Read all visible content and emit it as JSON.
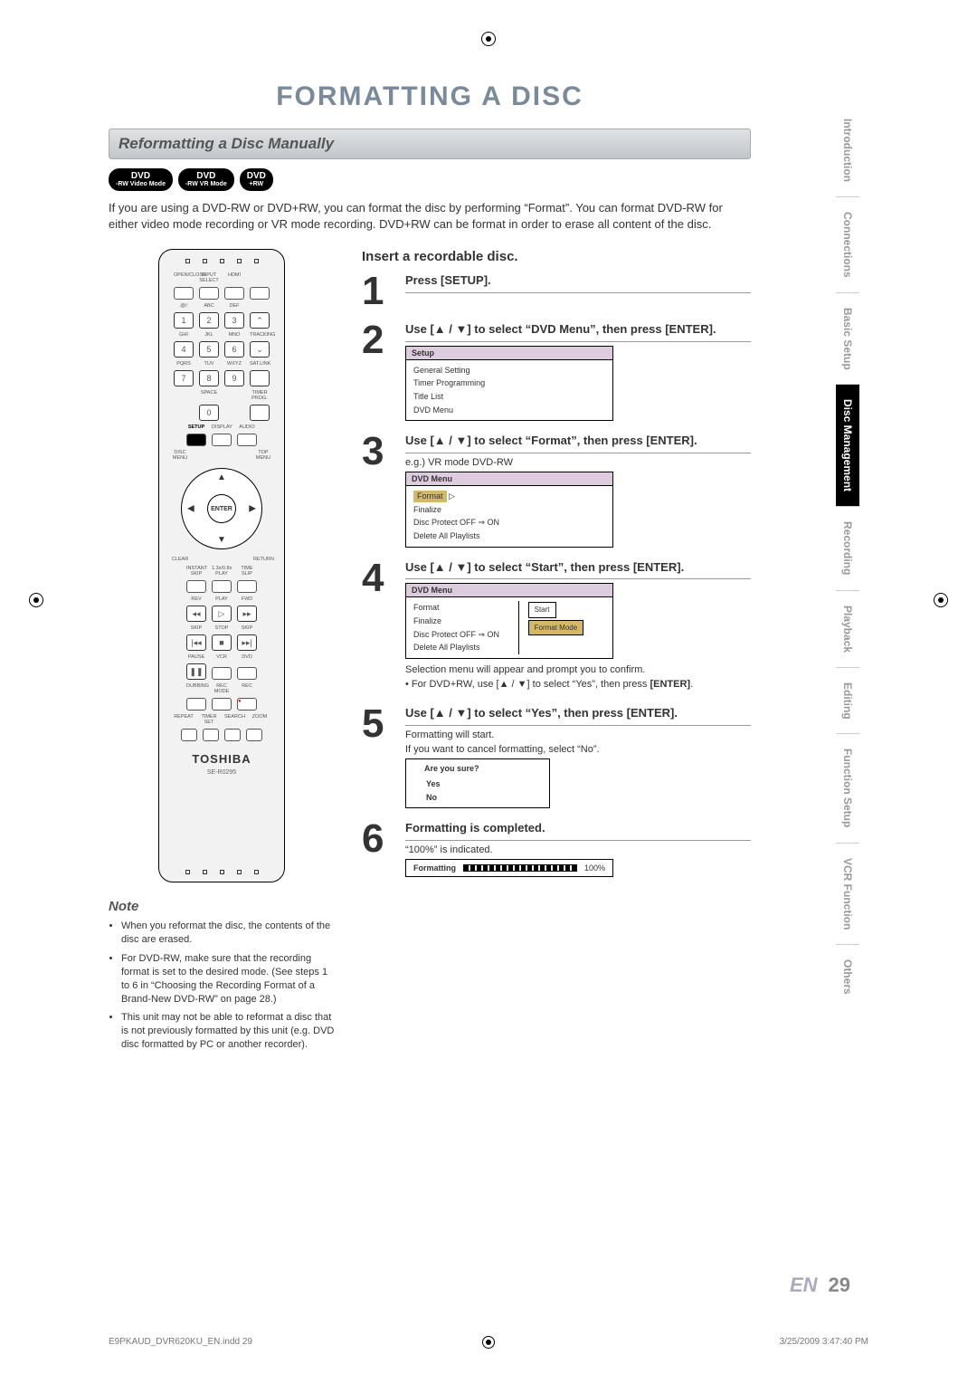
{
  "page_title": "FORMATTING A DISC",
  "subtitle": "Reformatting a Disc Manually",
  "badges": [
    {
      "top": "DVD",
      "bottom": "-RW Video Mode"
    },
    {
      "top": "DVD",
      "bottom": "-RW VR Mode"
    },
    {
      "top": "DVD",
      "bottom": "+RW"
    }
  ],
  "intro": "If you are using a DVD-RW or DVD+RW, you can format the disc by performing “Format”. You can format DVD-RW for either video mode recording or VR mode recording. DVD+RW can be format in order to erase all content of the disc.",
  "remote": {
    "brand": "TOSHIBA",
    "model": "SE-R0295",
    "labels": {
      "openclose": "OPEN/CLOSE",
      "inputsel": "INPUT SELECT",
      "hdmi": "HDMI",
      "abc": "ABC",
      "def": "DEF",
      "ghi": "GHI",
      "jkl": "JKL",
      "mno": "MNO",
      "tracking": "TRACKING",
      "pqrs": "PQRS",
      "tuv": "TUV",
      "wxyz": "WXYZ",
      "satlink": "SAT.LINK",
      "space": "SPACE",
      "timerprog": "TIMER PROG.",
      "setup": "SETUP",
      "display": "DISPLAY",
      "audio": "AUDIO",
      "discmenu": "DISC MENU",
      "topmenu": "TOP MENU",
      "enter": "ENTER",
      "clear": "CLEAR",
      "return": "RETURN",
      "instantskip": "INSTANT SKIP",
      "play13": "1.3x/0.8x PLAY",
      "timeslip": "TIME SLIP",
      "rev": "REV",
      "play": "PLAY",
      "fwd": "FWD",
      "skip": "SKIP",
      "stop": "STOP",
      "pause": "PAUSE",
      "vcr": "VCR",
      "dvd": "DVD",
      "dubbing": "DUBBING",
      "recmode": "REC MODE",
      "rec": "REC",
      "repeat": "REPEAT",
      "timerset": "TIMER SET",
      "search": "SEARCH",
      "zoom": "ZOOM"
    },
    "nums": {
      "1": "1",
      "2": "2",
      "3": "3",
      "4": "4",
      "5": "5",
      "6": "6",
      "7": "7",
      "8": "8",
      "9": "9",
      "0": "0"
    }
  },
  "note_title": "Note",
  "notes": [
    "When you reformat the disc, the contents of the disc are erased.",
    "For DVD-RW, make sure that the recording format is set to the desired mode. (See steps 1 to 6 in “Choosing the Recording Format of a Brand-New DVD-RW” on page 28.)",
    "This unit may not be able to reformat a disc that is not previously formatted by this unit (e.g. DVD disc formatted by PC or another recorder)."
  ],
  "insert_title": "Insert a recordable disc.",
  "steps": {
    "1": {
      "head": "Press [SETUP]."
    },
    "2": {
      "head": "Use [▲ / ▼] to select “DVD Menu”, then press [ENTER].",
      "osd_title": "Setup",
      "osd_items": [
        "General Setting",
        "Timer Programming",
        "Title List",
        "DVD Menu"
      ]
    },
    "3": {
      "head": "Use [▲ / ▼] to select “Format”, then press [ENTER].",
      "sub": "e.g.) VR mode DVD-RW",
      "osd_title": "DVD Menu",
      "osd_items": [
        "Format",
        "Finalize",
        "Disc Protect OFF ⇒ ON",
        "Delete All Playlists"
      ],
      "hl": "Format"
    },
    "4": {
      "head": "Use [▲ / ▼] to select “Start”, then press [ENTER].",
      "osd_title": "DVD Menu",
      "osd_left": [
        "Format",
        "Finalize",
        "Disc Protect OFF ⇒ ON",
        "Delete All Playlists"
      ],
      "osd_right": [
        "Start",
        "Format Mode"
      ],
      "after1": "Selection menu will appear and prompt you to confirm.",
      "after2_a": "• For DVD+RW, use [▲ / ▼] to select “Yes”, then press ",
      "after2_b": "[ENTER]"
    },
    "5": {
      "head": "Use [▲ / ▼] to select “Yes”, then press [ENTER].",
      "line1": "Formatting will start.",
      "line2": "If you want to cancel formatting, select “No”.",
      "osd_title": "Are you sure?",
      "osd_items": [
        "Yes",
        "No"
      ]
    },
    "6": {
      "head": "Formatting is completed.",
      "sub": "“100%” is indicated.",
      "progress_label": "Formatting",
      "progress_pct": "100%"
    }
  },
  "tabs": [
    "Introduction",
    "Connections",
    "Basic Setup",
    "Disc Management",
    "Recording",
    "Playback",
    "Editing",
    "Function Setup",
    "VCR Function",
    "Others"
  ],
  "active_tab": "Disc Management",
  "page_lang": "EN",
  "page_num": "29",
  "doc_footer_left": "E9PKAUD_DVR620KU_EN.indd   29",
  "doc_footer_right": "3/25/2009   3:47:40 PM"
}
